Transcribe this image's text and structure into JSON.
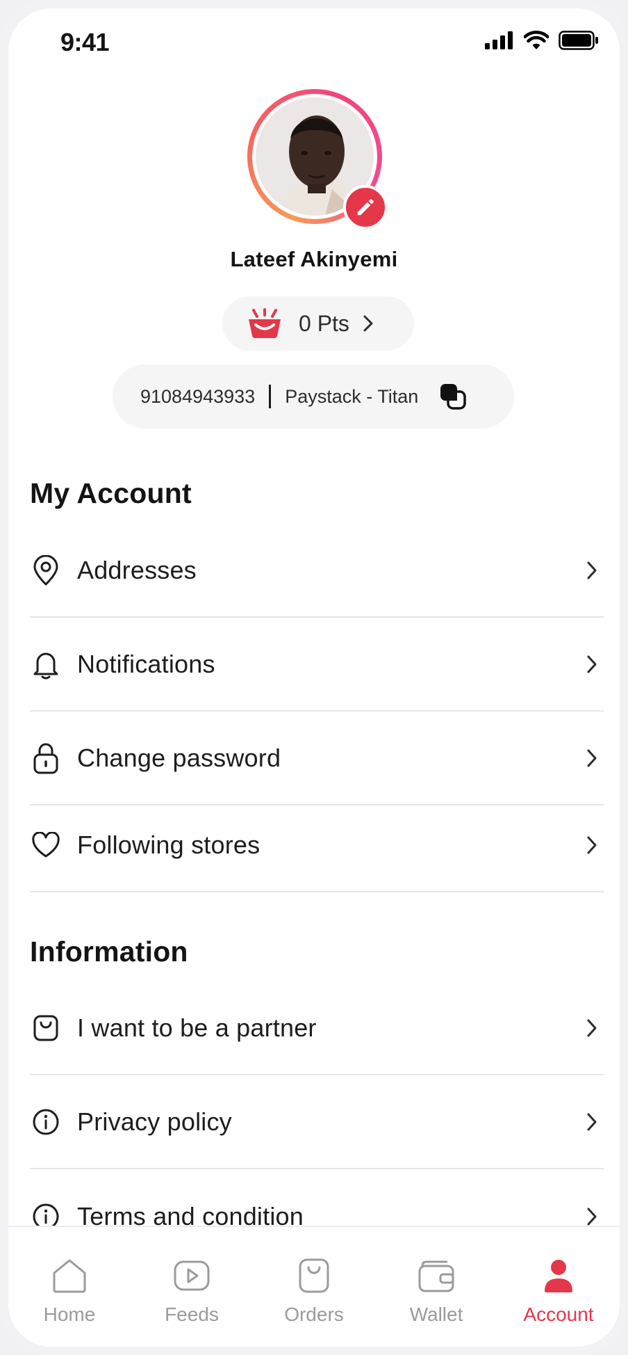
{
  "status_bar": {
    "time": "9:41"
  },
  "profile": {
    "name": "Lateef Akinyemi",
    "points": "0 Pts",
    "account_number": "91084943933",
    "bank": "Paystack - Titan"
  },
  "sections": {
    "my_account": {
      "title": "My Account",
      "items": [
        {
          "label": "Addresses",
          "icon": "location-pin-icon"
        },
        {
          "label": "Notifications",
          "icon": "bell-icon"
        },
        {
          "label": "Change password",
          "icon": "lock-icon"
        },
        {
          "label": "Following stores",
          "icon": "heart-icon"
        }
      ]
    },
    "information": {
      "title": "Information",
      "items": [
        {
          "label": "I want to be a partner",
          "icon": "shopping-bag-icon"
        },
        {
          "label": "Privacy policy",
          "icon": "info-icon"
        },
        {
          "label": "Terms and condition",
          "icon": "info-icon"
        }
      ]
    }
  },
  "tabbar": {
    "tabs": [
      {
        "label": "Home",
        "icon": "home-icon"
      },
      {
        "label": "Feeds",
        "icon": "play-icon"
      },
      {
        "label": "Orders",
        "icon": "bag-icon"
      },
      {
        "label": "Wallet",
        "icon": "wallet-icon"
      },
      {
        "label": "Account",
        "icon": "user-icon",
        "active": true
      }
    ]
  },
  "colors": {
    "accent": "#e5374a",
    "inactive": "#9b9b9b",
    "pill_bg": "#f5f5f5"
  }
}
